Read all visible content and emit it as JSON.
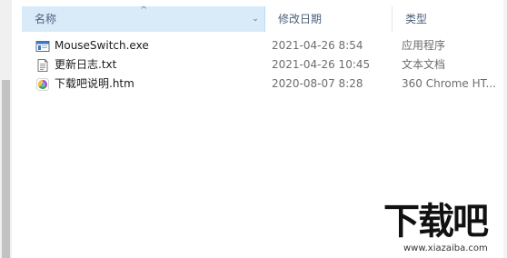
{
  "columns": {
    "name": "名称",
    "date": "修改日期",
    "type": "类型"
  },
  "files": [
    {
      "icon": "exe-window-icon",
      "name": "MouseSwitch.exe",
      "date": "2021-04-26 8:54",
      "type": "应用程序"
    },
    {
      "icon": "text-document-icon",
      "name": "更新日志.txt",
      "date": "2021-04-26 10:45",
      "type": "文本文档"
    },
    {
      "icon": "chrome-html-icon",
      "name": "下载吧说明.htm",
      "date": "2020-08-07 8:28",
      "type": "360 Chrome HT..."
    }
  ],
  "watermark": {
    "logo_text": "下载吧",
    "url": "www.xiazaiba.com"
  },
  "colors": {
    "header_selected_bg": "#d9ebf9",
    "header_text": "#4c607a",
    "secondary_text": "#6d6d6d"
  }
}
